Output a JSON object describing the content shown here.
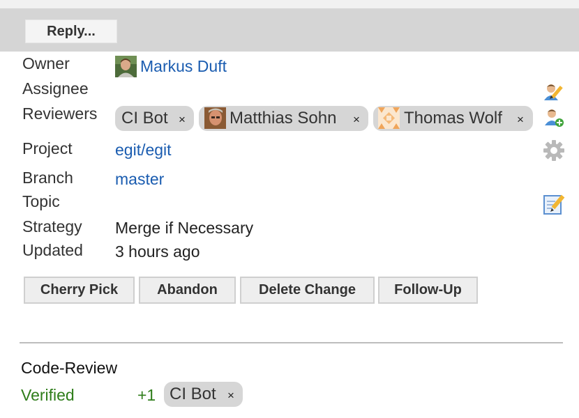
{
  "toolbar": {
    "reply_label": "Reply..."
  },
  "info": {
    "owner_label": "Owner",
    "owner_name": "Markus Duft",
    "assignee_label": "Assignee",
    "reviewers_label": "Reviewers",
    "reviewers": [
      {
        "name": "CI Bot",
        "remove": "×"
      },
      {
        "name": "Matthias Sohn",
        "remove": "×"
      },
      {
        "name": "Thomas Wolf",
        "remove": "×"
      }
    ],
    "project_label": "Project",
    "project_value": "egit/egit",
    "branch_label": "Branch",
    "branch_value": "master",
    "topic_label": "Topic",
    "strategy_label": "Strategy",
    "strategy_value": "Merge if Necessary",
    "updated_label": "Updated",
    "updated_value": "3 hours ago"
  },
  "actions": {
    "cherry_pick": "Cherry Pick",
    "abandon": "Abandon",
    "delete_change": "Delete Change",
    "follow_up": "Follow-Up"
  },
  "labels": {
    "code_review": "Code-Review",
    "verified": "Verified",
    "verified_score": "+1",
    "verified_by": "CI Bot",
    "verified_remove": "×"
  },
  "icons": {
    "edit_assignee": "edit-assignee-icon",
    "add_reviewer": "add-reviewer-icon",
    "project_settings": "gear-icon",
    "edit_topic": "edit-topic-icon"
  },
  "colors": {
    "link": "#1a5cb0",
    "approved": "#2e7d1a",
    "toolbar": "#d5d5d5",
    "chip": "#d6d6d6"
  }
}
